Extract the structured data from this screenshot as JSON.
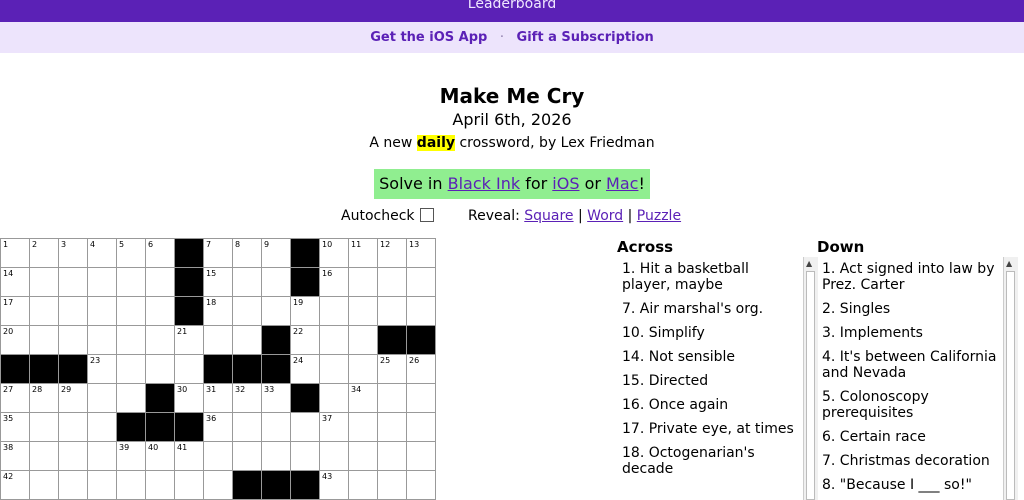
{
  "topbar": {
    "leaderboard_label": "Leaderboard"
  },
  "subbar": {
    "ios_app_label": "Get the iOS App",
    "separator": "·",
    "gift_label": "Gift a Subscription"
  },
  "puzzle": {
    "title": "Make Me Cry",
    "date": "April 6th, 2026",
    "byline_prefix": "A new ",
    "byline_highlight": "daily",
    "byline_suffix": " crossword, by Lex Friedman"
  },
  "promo": {
    "prefix": "Solve in ",
    "black_ink": "Black Ink",
    "for": " for ",
    "ios": "iOS",
    "or": " or ",
    "mac": "Mac",
    "suffix": "!"
  },
  "controls": {
    "autocheck_label": "Autocheck",
    "reveal_label": "Reveal:",
    "square": "Square",
    "sep": "|",
    "word": "Word",
    "puzzle": "Puzzle"
  },
  "grid": {
    "rows": [
      "......#...#....",
      "......#...#....",
      "......#........",
      ".........#...##",
      "###....###.....",
      ".....#....#....",
      "....###........",
      "...............",
      "........###...."
    ],
    "numbers": [
      [
        1,
        2,
        3,
        4,
        5,
        6,
        0,
        7,
        8,
        9,
        0,
        10,
        11,
        12,
        13
      ],
      [
        14,
        0,
        0,
        0,
        0,
        0,
        0,
        15,
        0,
        0,
        0,
        16,
        0,
        0,
        0
      ],
      [
        17,
        0,
        0,
        0,
        0,
        0,
        0,
        18,
        0,
        0,
        19,
        0,
        0,
        0,
        0
      ],
      [
        20,
        0,
        0,
        0,
        0,
        0,
        21,
        0,
        0,
        0,
        22,
        0,
        0,
        0,
        0
      ],
      [
        0,
        0,
        0,
        23,
        0,
        0,
        0,
        0,
        0,
        0,
        24,
        0,
        0,
        25,
        26
      ],
      [
        27,
        28,
        29,
        0,
        0,
        0,
        30,
        31,
        32,
        33,
        0,
        0,
        34,
        0,
        0
      ],
      [
        35,
        0,
        0,
        0,
        0,
        0,
        0,
        36,
        0,
        0,
        0,
        37,
        0,
        0,
        0
      ],
      [
        38,
        0,
        0,
        0,
        39,
        40,
        41,
        0,
        0,
        0,
        0,
        0,
        0,
        0,
        0
      ],
      [
        42,
        0,
        0,
        0,
        0,
        0,
        0,
        0,
        0,
        0,
        0,
        43,
        0,
        0,
        0
      ]
    ]
  },
  "across": {
    "heading": "Across",
    "clues": [
      "1. Hit a basketball player, maybe",
      "7. Air marshal's org.",
      "10. Simplify",
      "14. Not sensible",
      "15. Directed",
      "16. Once again",
      "17. Private eye, at times",
      "18. Octogenarian's decade"
    ]
  },
  "down": {
    "heading": "Down",
    "clues": [
      "1. Act signed into law by Prez. Carter",
      "2. Singles",
      "3. Implements",
      "4. It's between California and Nevada",
      "5. Colonoscopy prerequisites",
      "6. Certain race",
      "7. Christmas decoration",
      "8. \"Because I ___ so!\""
    ]
  },
  "icons": {
    "scroll_up": "scroll-up-arrow-icon"
  }
}
